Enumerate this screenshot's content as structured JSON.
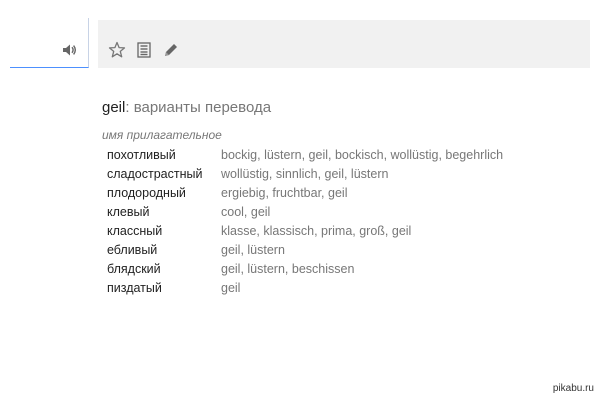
{
  "toolbar": {
    "icons": [
      "speaker-icon",
      "star-icon",
      "phrasebook-icon",
      "pencil-icon"
    ]
  },
  "dictionary": {
    "word": "geil",
    "heading_suffix": ": варианты перевода",
    "part_of_speech": "имя прилагательное",
    "entries": [
      {
        "word": "похотливый",
        "translations": "bockig, lüstern, geil, bockisch, wollüstig, begehrlich"
      },
      {
        "word": "сладострастный",
        "translations": "wollüstig, sinnlich, geil, lüstern"
      },
      {
        "word": "плодородный",
        "translations": "ergiebig, fruchtbar, geil"
      },
      {
        "word": "клевый",
        "translations": "cool, geil"
      },
      {
        "word": "классный",
        "translations": "klasse, klassisch, prima, groß, geil"
      },
      {
        "word": "ебливый",
        "translations": "geil, lüstern"
      },
      {
        "word": "блядский",
        "translations": "geil, lüstern, beschissen"
      },
      {
        "word": "пиздатый",
        "translations": "geil"
      }
    ]
  },
  "watermark": "pikabu.ru"
}
